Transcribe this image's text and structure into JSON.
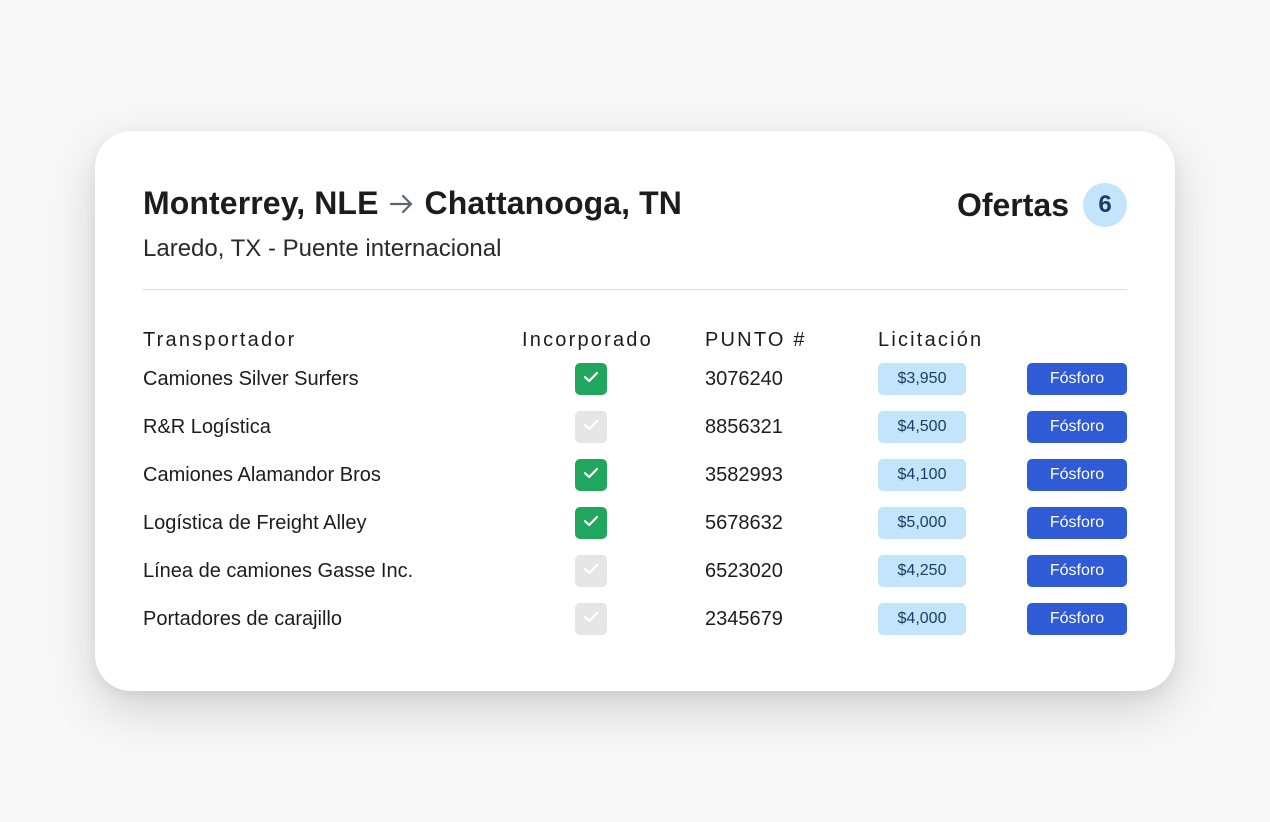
{
  "header": {
    "origin": "Monterrey, NLE",
    "destination": "Chattanooga, TN",
    "crossing": "Laredo, TX - Puente internacional",
    "offers_label": "Ofertas",
    "offers_count": "6"
  },
  "columns": {
    "carrier": "Transportador",
    "incorporated": "Incorporado",
    "punto": "PUNTO #",
    "bid": "Licitación"
  },
  "colors": {
    "check_on": "#21a65e",
    "check_off": "#e6e6e6",
    "bid_badge": "#c2e5fb",
    "match_button": "#2f5bd6"
  },
  "rows": [
    {
      "carrier": "Camiones Silver Surfers",
      "incorporated": true,
      "punto": "3076240",
      "bid": "$3,950",
      "action": "Fósforo"
    },
    {
      "carrier": "R&R Logística",
      "incorporated": false,
      "punto": "8856321",
      "bid": "$4,500",
      "action": "Fósforo"
    },
    {
      "carrier": "Camiones Alamandor Bros",
      "incorporated": true,
      "punto": "3582993",
      "bid": "$4,100",
      "action": "Fósforo"
    },
    {
      "carrier": "Logística de Freight Alley",
      "incorporated": true,
      "punto": "5678632",
      "bid": "$5,000",
      "action": "Fósforo"
    },
    {
      "carrier": "Línea de camiones Gasse Inc.",
      "incorporated": false,
      "punto": "6523020",
      "bid": "$4,250",
      "action": "Fósforo"
    },
    {
      "carrier": "Portadores de carajillo",
      "incorporated": false,
      "punto": "2345679",
      "bid": "$4,000",
      "action": "Fósforo"
    }
  ]
}
